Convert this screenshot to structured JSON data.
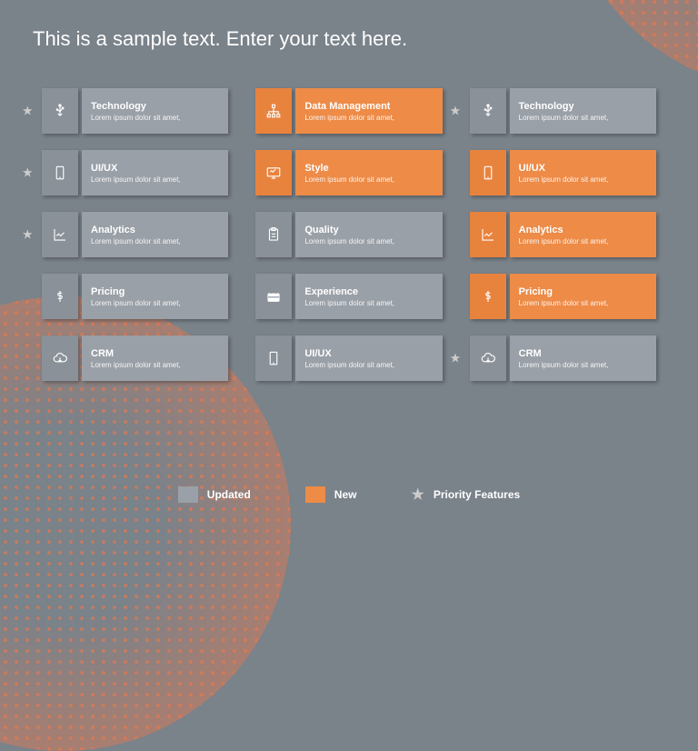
{
  "title": "This is a sample text. Enter your text here.",
  "desc": "Lorem ipsum dolor sit amet,",
  "cards": [
    {
      "title": "Technology",
      "icon": "usb",
      "variant": "gray",
      "star": true
    },
    {
      "title": "Data Management",
      "icon": "hierarchy",
      "variant": "orange",
      "star": false
    },
    {
      "title": "Technology",
      "icon": "usb",
      "variant": "gray",
      "star": true
    },
    {
      "title": "UI/UX",
      "icon": "phone",
      "variant": "gray",
      "star": true
    },
    {
      "title": "Style",
      "icon": "monitor",
      "variant": "orange",
      "star": false
    },
    {
      "title": "UI/UX",
      "icon": "phone",
      "variant": "orange",
      "star": false
    },
    {
      "title": "Analytics",
      "icon": "chart",
      "variant": "gray",
      "star": true
    },
    {
      "title": "Quality",
      "icon": "clipboard",
      "variant": "gray",
      "star": false
    },
    {
      "title": "Analytics",
      "icon": "chart",
      "variant": "orange",
      "star": false
    },
    {
      "title": "Pricing",
      "icon": "dollar",
      "variant": "gray",
      "star": false
    },
    {
      "title": "Experience",
      "icon": "briefcase",
      "variant": "gray",
      "star": false
    },
    {
      "title": "Pricing",
      "icon": "dollar",
      "variant": "orange",
      "star": false
    },
    {
      "title": "CRM",
      "icon": "cloud",
      "variant": "gray",
      "star": false
    },
    {
      "title": "UI/UX",
      "icon": "phone",
      "variant": "gray",
      "star": false
    },
    {
      "title": "CRM",
      "icon": "cloud",
      "variant": "gray",
      "star": true
    }
  ],
  "legend": {
    "updated": "Updated",
    "new": "New",
    "priority": "Priority Features"
  }
}
